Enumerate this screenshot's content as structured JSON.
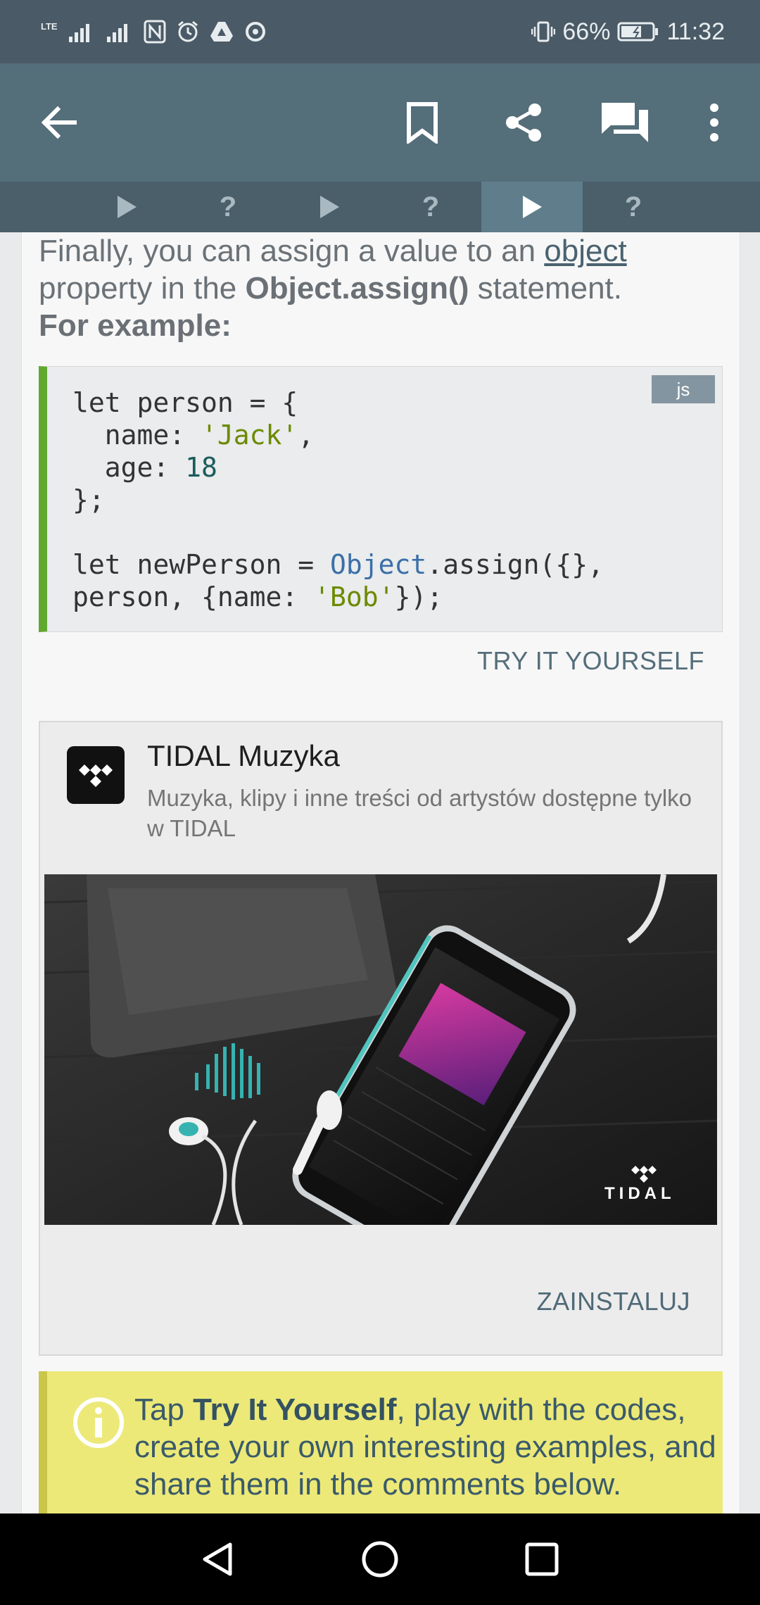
{
  "status_bar": {
    "carrier": "LTE",
    "battery_text": "66%",
    "battery_level": 0.66,
    "time": "11:32"
  },
  "app_bar": {
    "back_icon": "arrow-left-icon",
    "actions": [
      "bookmark-icon",
      "share-icon",
      "comments-icon",
      "more-vert-icon"
    ]
  },
  "quiz_tabs": [
    {
      "type": "lesson",
      "label": ""
    },
    {
      "type": "quiz",
      "label": "?"
    },
    {
      "type": "lesson",
      "label": ""
    },
    {
      "type": "quiz",
      "label": "?"
    },
    {
      "type": "lesson",
      "label": "",
      "active": true
    },
    {
      "type": "quiz",
      "label": "?"
    }
  ],
  "lesson": {
    "intro_before": "Finally, you can assign a value to an ",
    "intro_link": "object",
    "intro_middle": " property in the ",
    "intro_code": "Object.assign()",
    "intro_after": " statement.",
    "example_label": "For example:",
    "code_lang": "js",
    "try_label": "TRY IT YOURSELF"
  },
  "ad": {
    "title": "TIDAL Muzyka",
    "description": "Muzyka, klipy i inne treści od artystów dostępne tylko w TIDAL",
    "brand_wordmark": "TIDAL",
    "cta": "ZAINSTALUJ"
  },
  "note": {
    "prefix": "Tap ",
    "bold": "Try It Yourself",
    "suffix": ", play with the codes, create your own interesting examples, and share them in the comments below."
  },
  "nav_bar": [
    "back-triangle-icon",
    "home-circle-icon",
    "recents-square-icon"
  ],
  "colors": {
    "status_bar": "#4a5a66",
    "app_bar": "#546e7a",
    "code_accent": "#61a82f",
    "note_bg": "#ece979"
  }
}
